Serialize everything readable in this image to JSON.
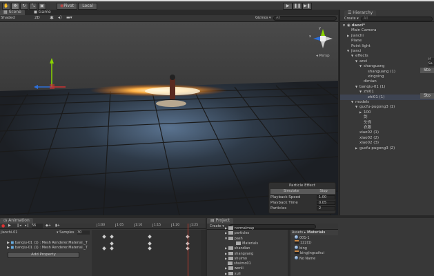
{
  "toolbar": {
    "tools": [
      "hand",
      "move",
      "rotate",
      "scale",
      "rect"
    ],
    "pivot": "Pivot",
    "local": "Local",
    "play": "▶",
    "pause": "❚❚",
    "step": "▶❚"
  },
  "scene": {
    "tabs": [
      "Scene",
      "Game"
    ],
    "shading": "Shaded",
    "mode_2d": "2D",
    "gizmos": "Gizmos",
    "search": "All",
    "persp": "Persp",
    "gizmo_y": "y",
    "gizmo_x": "x"
  },
  "particle_effect": {
    "title": "Particle Effect",
    "simulate": "Simulate",
    "stop": "Stop",
    "rows": [
      {
        "label": "Playback Speed",
        "value": "1.00"
      },
      {
        "label": "Playback Time",
        "value": "0.05"
      },
      {
        "label": "Particles",
        "value": "2"
      }
    ]
  },
  "hierarchy": {
    "title": "Hierarchy",
    "create": "Create",
    "search": "All",
    "items": [
      {
        "label": "daoci*",
        "depth": 0,
        "arrow": "▼",
        "scene": true
      },
      {
        "label": "Main Camera",
        "depth": 1,
        "arrow": ""
      },
      {
        "label": "jianchi",
        "depth": 1,
        "arrow": "▶"
      },
      {
        "label": "Plane",
        "depth": 1,
        "arrow": ""
      },
      {
        "label": "Point light",
        "depth": 1,
        "arrow": ""
      },
      {
        "label": "jianci",
        "depth": 1,
        "arrow": "▼"
      },
      {
        "label": "effects",
        "depth": 2,
        "arrow": "▼"
      },
      {
        "label": "anci",
        "depth": 3,
        "arrow": "▼"
      },
      {
        "label": "shanguang",
        "depth": 4,
        "arrow": "▼"
      },
      {
        "label": "shanguang (1)",
        "depth": 5,
        "arrow": ""
      },
      {
        "label": "xingxing",
        "depth": 5,
        "arrow": ""
      },
      {
        "label": "dimian",
        "depth": 4,
        "arrow": ""
      },
      {
        "label": "banqiu-01 (1)",
        "depth": 3,
        "arrow": "▼"
      },
      {
        "label": "zhi01",
        "depth": 4,
        "arrow": "▼"
      },
      {
        "label": "zhi01 (1)",
        "depth": 5,
        "arrow": "",
        "selected": true
      },
      {
        "label": "models",
        "depth": 2,
        "arrow": "▼"
      },
      {
        "label": "gucfu-pugong3 (1)",
        "depth": 3,
        "arrow": "▼"
      },
      {
        "label": "100",
        "depth": 4,
        "arrow": "▶"
      },
      {
        "label": "剑",
        "depth": 4,
        "arrow": ""
      },
      {
        "label": "头饰",
        "depth": 4,
        "arrow": ""
      },
      {
        "label": "衣服",
        "depth": 4,
        "arrow": ""
      },
      {
        "label": "xiao02 (1)",
        "depth": 3,
        "arrow": ""
      },
      {
        "label": "xiao02 (2)",
        "depth": 3,
        "arrow": ""
      },
      {
        "label": "xiao02 (3)",
        "depth": 3,
        "arrow": ""
      },
      {
        "label": "gucfu-pugong3 (2)",
        "depth": 3,
        "arrow": "▶"
      }
    ]
  },
  "inspector": {
    "partial": [
      "If",
      "Sa",
      "Sto",
      "Sto"
    ]
  },
  "animation": {
    "title": "Animation",
    "frame": "56",
    "clip": "jianchi-01",
    "samples_label": "Samples",
    "samples": "30",
    "ticks": [
      "1:00",
      "1:05",
      "1:10",
      "1:15",
      "1:20",
      "1:25"
    ],
    "tracks": [
      "banqiu-01 (1) : Mesh Renderer.Material._T",
      "banqiu-01 (1) : Mesh Renderer.Material._T"
    ],
    "add_property": "Add Property"
  },
  "project": {
    "title": "Project",
    "create": "Create",
    "folders": [
      {
        "label": "normalmap",
        "arrow": "▶"
      },
      {
        "label": "particles",
        "arrow": "▶"
      },
      {
        "label": "pash",
        "arrow": "▼"
      },
      {
        "label": "Materials",
        "arrow": "",
        "child": true
      },
      {
        "label": "shandian",
        "arrow": "▶"
      },
      {
        "label": "shangyang",
        "arrow": "▶"
      },
      {
        "label": "shuimo",
        "arrow": "▶"
      },
      {
        "label": "shuimo01",
        "arrow": ""
      },
      {
        "label": "wenli",
        "arrow": "▶"
      },
      {
        "label": "xuli",
        "arrow": "▶"
      }
    ],
    "breadcrumb": [
      "Assets",
      "Materials"
    ],
    "assets": [
      {
        "label": "001-1",
        "icon": "sphere"
      },
      {
        "label": "122(1)",
        "icon": "texture"
      },
      {
        "label": "bing",
        "icon": "sphere"
      },
      {
        "label": "bingjingcaihui",
        "icon": "texture"
      },
      {
        "label": "No Name",
        "icon": "sphere"
      }
    ]
  },
  "colors": {
    "accent_red": "#c0392b",
    "selection": "#3e4452",
    "glow": "#ffb347"
  }
}
